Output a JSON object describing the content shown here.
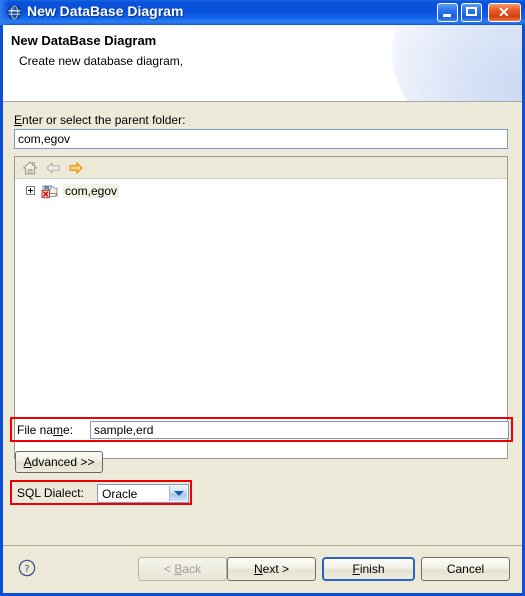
{
  "window": {
    "title": "New DataBase Diagram",
    "icon": "globe-icon",
    "controls": {
      "minimize": "Minimize",
      "maximize": "Maximize",
      "close": "Close"
    }
  },
  "header": {
    "title": "New DataBase Diagram",
    "subtitle": "Create new database diagram,"
  },
  "form": {
    "parent_folder_label_pre": "E",
    "parent_folder_label_post": "nter or select the parent folder:",
    "parent_folder_value": "com,egov",
    "parent_folder_placeholder": "",
    "filename_label_pre": "File na",
    "filename_label_mnem": "m",
    "filename_label_post": "e:",
    "filename_value": "sample,erd",
    "filename_placeholder": "",
    "advanced_label_mnem": "A",
    "advanced_label_post": "dvanced >>",
    "dialect_label": "SQL Dialect:",
    "dialect_value": "Oracle",
    "dialect_options": [
      "Oracle"
    ]
  },
  "tree": {
    "toolbar": [
      "home-icon",
      "back-arrow-icon",
      "forward-arrow-icon"
    ],
    "nodes": [
      {
        "label": "com,egov",
        "icon": "java-package-error-icon",
        "expanded": false,
        "selected": true
      }
    ]
  },
  "footer": {
    "help": "?",
    "back_pre": "< ",
    "back_mnem": "B",
    "back_post": "ack",
    "next_pre": "",
    "next_mnem": "N",
    "next_post": "ext >",
    "finish_mnem": "F",
    "finish_post": "inish",
    "cancel_label": "Cancel"
  },
  "colors": {
    "titlebar_blue": "#0a52dc",
    "dialog_border": "#0a4fd6",
    "body_beige": "#ece9d8",
    "highlight_red": "#ee0000",
    "default_button_border": "#2a64c8",
    "forward_arrow_orange": "#f0a000"
  }
}
